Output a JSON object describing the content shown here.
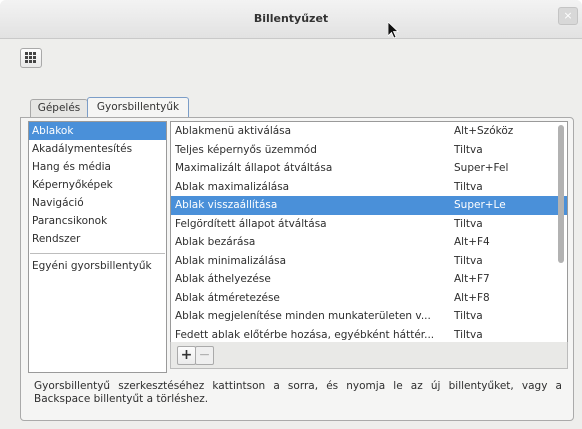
{
  "window": {
    "title": "Billentyűzet",
    "close_glyph": "×"
  },
  "toolbar": {
    "grid_icon": "grid-icon"
  },
  "tabs": [
    {
      "label": "Gépelés"
    },
    {
      "label": "Gyorsbillentyűk"
    }
  ],
  "categories": [
    "Ablakok",
    "Akadálymentesítés",
    "Hang és média",
    "Képernyőképek",
    "Navigáció",
    "Parancsikonok",
    "Rendszer"
  ],
  "custom_category": "Egyéni gyorsbillentyűk",
  "shortcuts": [
    {
      "action": "Ablakmenü aktiválása",
      "key": "Alt+Szóköz"
    },
    {
      "action": "Teljes képernyős üzemmód",
      "key": "Tiltva"
    },
    {
      "action": "Maximalizált állapot átváltása",
      "key": "Super+Fel"
    },
    {
      "action": "Ablak maximalizálása",
      "key": "Tiltva"
    },
    {
      "action": "Ablak visszaállítása",
      "key": "Super+Le"
    },
    {
      "action": "Felgördített állapot átváltása",
      "key": "Tiltva"
    },
    {
      "action": "Ablak bezárása",
      "key": "Alt+F4"
    },
    {
      "action": "Ablak minimalizálása",
      "key": "Tiltva"
    },
    {
      "action": "Ablak áthelyezése",
      "key": "Alt+F7"
    },
    {
      "action": "Ablak átméretezése",
      "key": "Alt+F8"
    },
    {
      "action": "Ablak megjelenítése minden munkaterületen v...",
      "key": "Tiltva"
    },
    {
      "action": "Fedett ablak előtérbe hozása, egyébként háttér...",
      "key": "Tiltva"
    }
  ],
  "list_buttons": {
    "add": "+",
    "remove": "−"
  },
  "help_text": "Gyorsbillentyű szerkesztéséhez kattintson a sorra, és nyomja le az új billentyűket, vagy a Backspace billentyűt a törléshez.",
  "colors": {
    "selection": "#4a90d9"
  }
}
